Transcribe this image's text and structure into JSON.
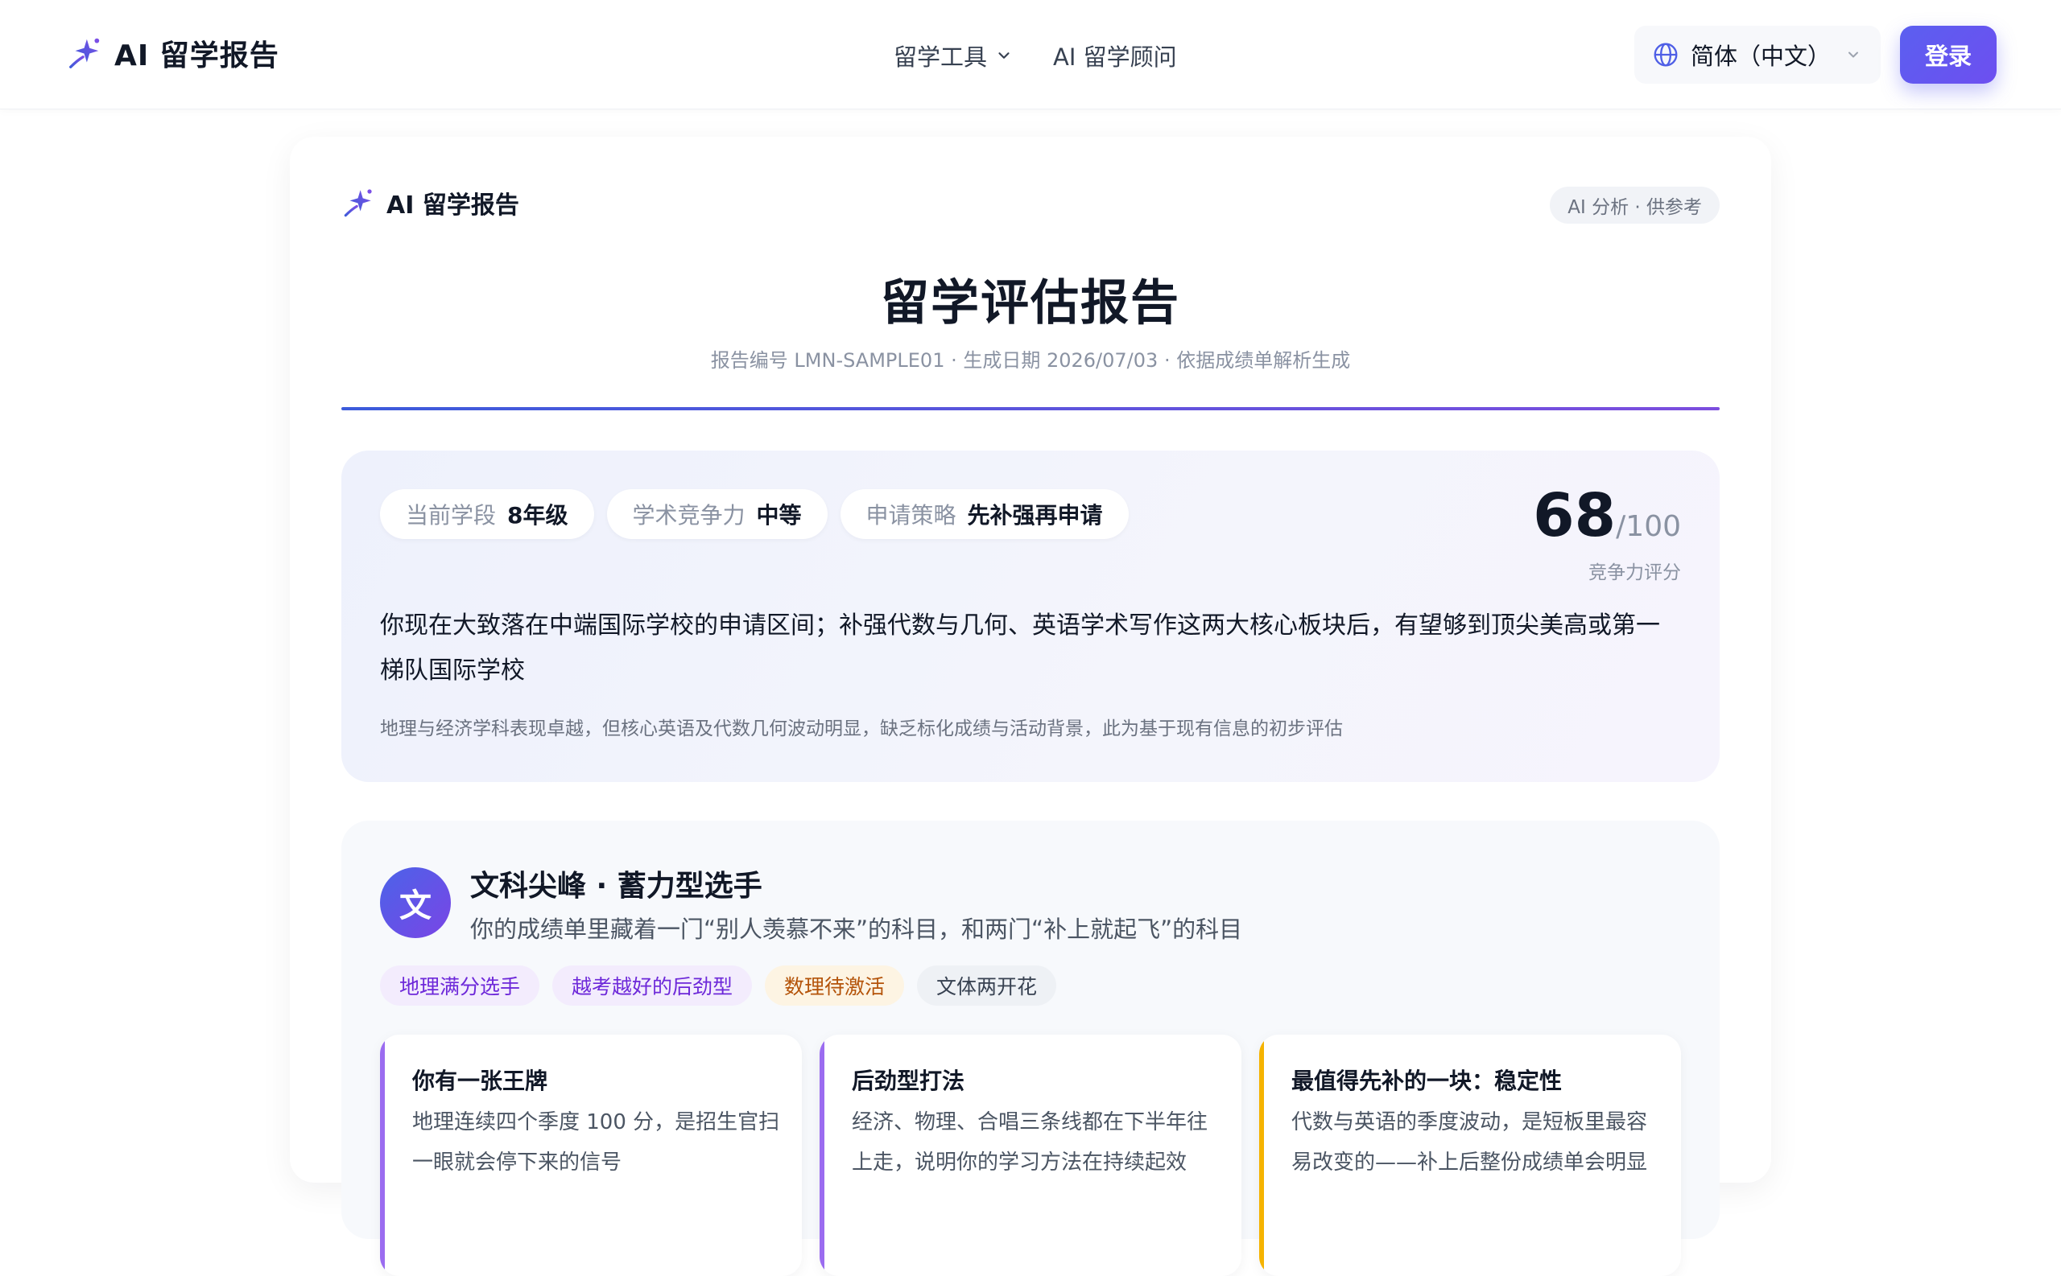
{
  "app": {
    "title": "AI 留学报告"
  },
  "nav": {
    "items": [
      {
        "label": "留学工具",
        "has_dropdown": true
      },
      {
        "label": "AI 留学顾问",
        "has_dropdown": false
      }
    ]
  },
  "language": {
    "label": "简体（中文）",
    "icon": "globe-icon"
  },
  "login": {
    "label": "登录"
  },
  "colors": {
    "accent": "#5b5ff0",
    "accent_purple": "#7c4dde",
    "text": "#111827",
    "muted": "#8a92a2"
  },
  "report": {
    "brand": "AI 留学报告",
    "tag": "AI 分析 · 供参考",
    "title": "留学评估报告",
    "meta": "报告编号 LMN-SAMPLE01 · 生成日期 2026/07/03 · 依据成绩单解析生成",
    "summary": {
      "pills": [
        {
          "key": "当前学段",
          "value": "8年级"
        },
        {
          "key": "学术竞争力",
          "value": "中等"
        },
        {
          "key": "申请策略",
          "value": "先补强再申请"
        }
      ],
      "score": {
        "value": "68",
        "denominator": "/100",
        "label": "竞争力评分"
      },
      "text": "你现在大致落在中端国际学校的申请区间；补强代数与几何、英语学术写作这两大核心板块后，有望够到顶尖美高或第一梯队国际学校",
      "note": "地理与经济学科表现卓越，但核心英语及代数几何波动明显，缺乏标化成绩与活动背景，此为基于现有信息的初步评估"
    },
    "profile": {
      "avatar": "文",
      "title": "文科尖峰 · 蓄力型选手",
      "subtitle": "你的成绩单里藏着一门“别人羡慕不来”的科目，和两门“补上就起飞”的科目",
      "tags": [
        {
          "label": "地理满分选手",
          "bg": "#f3ecfd",
          "fg": "#6d28d9"
        },
        {
          "label": "越考越好的后劲型",
          "bg": "#f3ecfd",
          "fg": "#6d28d9"
        },
        {
          "label": "数理待激活",
          "bg": "#fdf4e3",
          "fg": "#b45309"
        },
        {
          "label": "文体两开花",
          "bg": "#eef1f5",
          "fg": "#374151"
        }
      ],
      "cards": [
        {
          "title": "你有一张王牌",
          "body": "地理连续四个季度 100 分，是招生官扫一眼就会停下来的信号",
          "accent": "#9b6cf0"
        },
        {
          "title": "后劲型打法",
          "body": "经济、物理、合唱三条线都在下半年往上走，说明你的学习方法在持续起效",
          "accent": "#9b6cf0"
        },
        {
          "title": "最值得先补的一块：稳定性",
          "body": "代数与英语的季度波动，是短板里最容易改变的——补上后整份成绩单会明显",
          "accent": "#f5b300"
        }
      ]
    }
  }
}
